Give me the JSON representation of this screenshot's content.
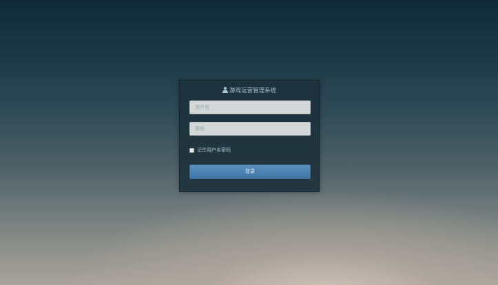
{
  "login": {
    "title": "游戏运营管理系统",
    "username_placeholder": "用户名",
    "password_placeholder": "密码",
    "remember_label": "记住用户名密码",
    "remember_checked": false,
    "submit_label": "登录"
  },
  "icons": {
    "title_icon": "user-icon"
  },
  "colors": {
    "panel_background": "#1c303a",
    "title_text": "#a9c4d2",
    "button_top": "#5a90bd",
    "button_bottom": "#3f76a6",
    "input_background": "#d3d7d8"
  }
}
